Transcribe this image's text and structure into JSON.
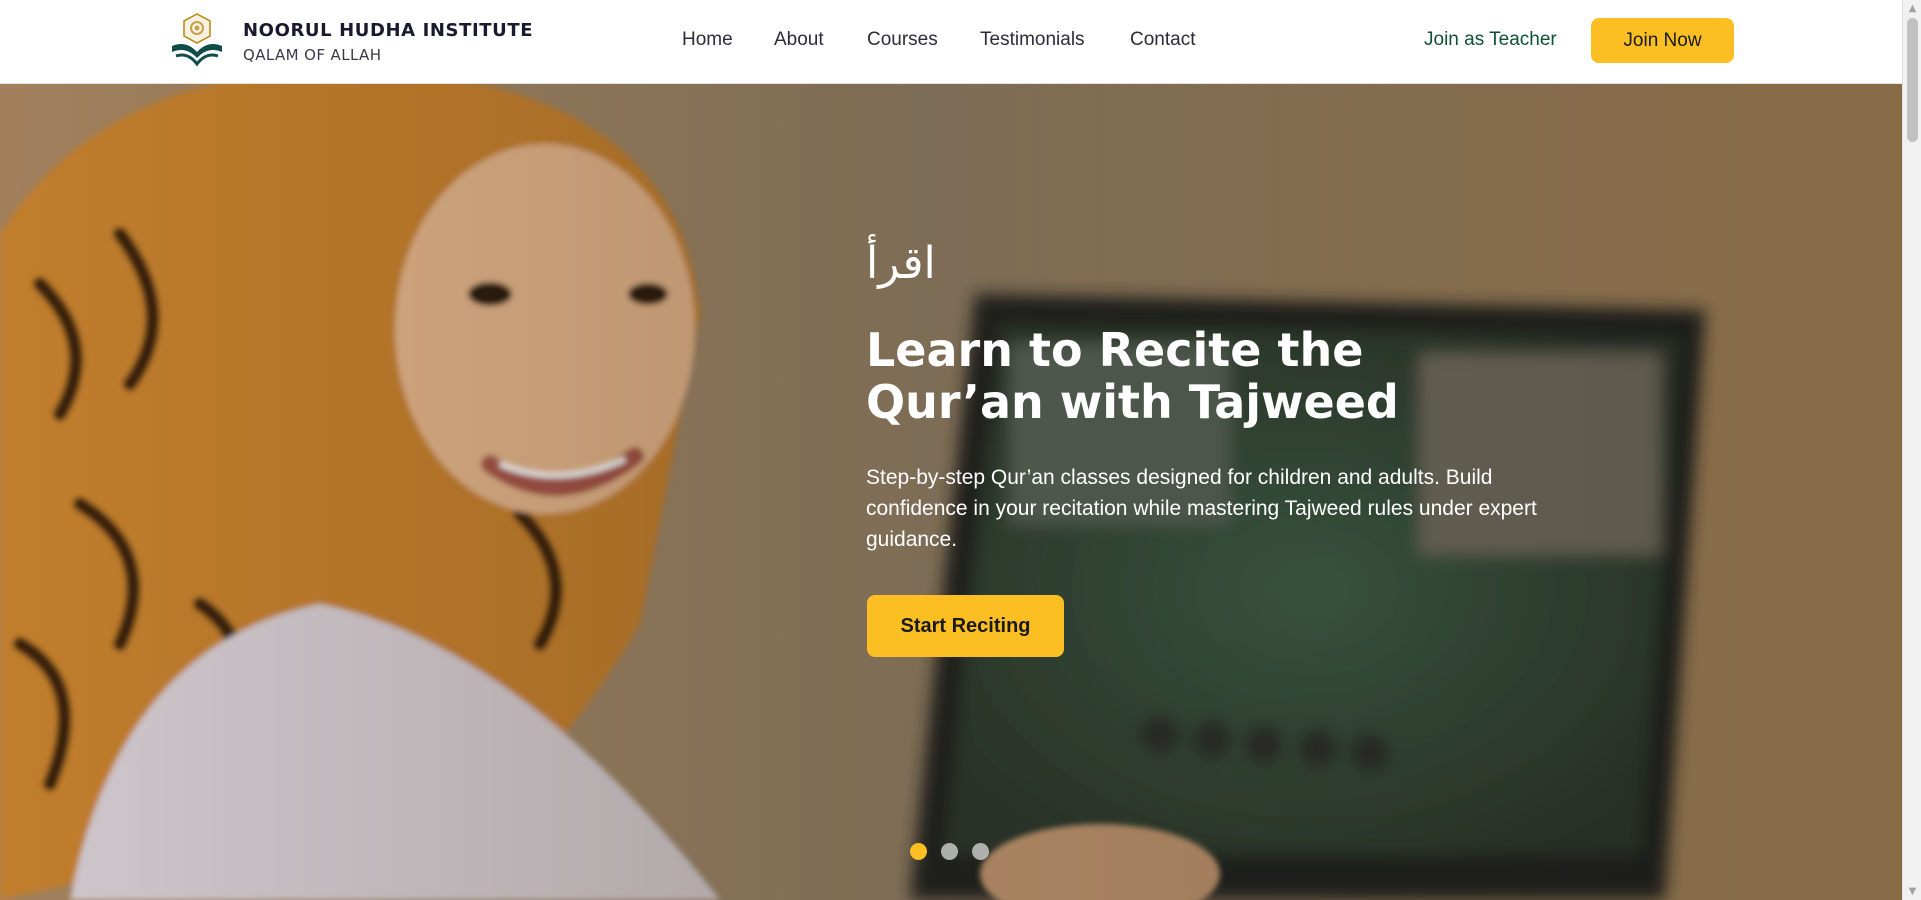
{
  "header": {
    "brand_name": "NOORUL HUDHA INSTITUTE",
    "brand_tagline": "QALAM OF ALLAH",
    "logo_icon": "book-compass-logo",
    "nav": [
      {
        "label": "Home"
      },
      {
        "label": "About"
      },
      {
        "label": "Courses"
      },
      {
        "label": "Testimonials"
      },
      {
        "label": "Contact"
      }
    ],
    "join_teacher_label": "Join as Teacher",
    "join_now_label": "Join Now"
  },
  "hero": {
    "arabic_text": "اقرأ",
    "title_line1": "Learn to Recite the",
    "title_line2": "Qur’an with Tajweed",
    "description": "Step-by-step Qur’an classes designed for children and adults. Build confidence in your recitation while mastering Tajweed rules under expert guidance.",
    "cta_label": "Start Reciting",
    "slides_total": 3,
    "active_slide": 1
  },
  "colors": {
    "accent": "#fbbf24",
    "brand_green": "#0f5132",
    "text_dark": "#1a1a2e"
  }
}
